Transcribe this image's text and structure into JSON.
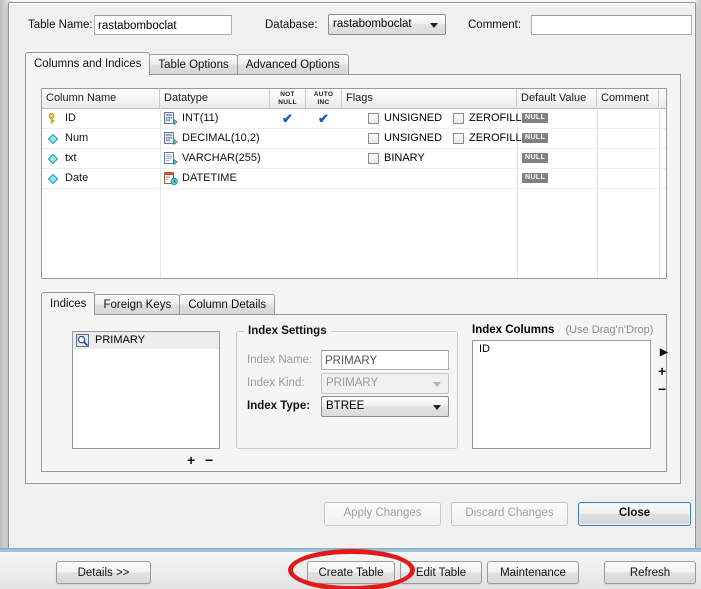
{
  "header": {
    "table_name_label": "Table Name:",
    "table_name_value": "rastabomboclat",
    "database_label": "Database:",
    "database_value": "rastabomboclat",
    "comment_label": "Comment:",
    "comment_value": ""
  },
  "main_tabs": [
    {
      "label": "Columns and Indices",
      "active": true
    },
    {
      "label": "Table Options",
      "active": false
    },
    {
      "label": "Advanced Options",
      "active": false
    }
  ],
  "columns_grid": {
    "headers": [
      "Column Name",
      "Datatype",
      "NOT NULL",
      "AUTO INC",
      "Flags",
      "Default Value",
      "Comment"
    ],
    "header_not_null_line1": "NOT",
    "header_not_null_line2": "NULL",
    "header_auto_inc_line1": "AUTO",
    "header_auto_inc_line2": "INC",
    "rows": [
      {
        "icon": "primary-key-icon",
        "name": "ID",
        "datatype": "INT(11)",
        "datatype_icon": "integer-type-icon",
        "not_null": true,
        "auto_inc": true,
        "flags": [
          {
            "label": "UNSIGNED",
            "checked": false
          },
          {
            "label": "ZEROFILL",
            "checked": false
          }
        ],
        "default_value": "NULL",
        "comment": ""
      },
      {
        "icon": "column-icon",
        "name": "Num",
        "datatype": "DECIMAL(10,2)",
        "datatype_icon": "numeric-type-icon",
        "not_null": false,
        "auto_inc": false,
        "flags": [
          {
            "label": "UNSIGNED",
            "checked": false
          },
          {
            "label": "ZEROFILL",
            "checked": false
          }
        ],
        "default_value": "NULL",
        "comment": ""
      },
      {
        "icon": "column-icon",
        "name": "txt",
        "datatype": "VARCHAR(255)",
        "datatype_icon": "text-type-icon",
        "not_null": false,
        "auto_inc": false,
        "flags": [
          {
            "label": "BINARY",
            "checked": false
          }
        ],
        "default_value": "NULL",
        "comment": ""
      },
      {
        "icon": "column-icon",
        "name": "Date",
        "datatype": "DATETIME",
        "datatype_icon": "datetime-type-icon",
        "not_null": false,
        "auto_inc": false,
        "flags": [],
        "default_value": "NULL",
        "comment": ""
      }
    ]
  },
  "sub_tabs": [
    {
      "label": "Indices",
      "active": true
    },
    {
      "label": "Foreign Keys",
      "active": false
    },
    {
      "label": "Column Details",
      "active": false
    }
  ],
  "indices_panel": {
    "index_list": [
      "PRIMARY"
    ],
    "add_button": "+",
    "remove_button": "−",
    "settings": {
      "group_title": "Index Settings",
      "index_name_label": "Index Name:",
      "index_name_value": "PRIMARY",
      "index_kind_label": "Index Kind:",
      "index_kind_value": "PRIMARY",
      "index_type_label": "Index Type:",
      "index_type_value": "BTREE"
    },
    "index_columns": {
      "title": "Index Columns",
      "hint": "(Use Drag'n'Drop)",
      "items": [
        "ID"
      ],
      "expand_button": "▶",
      "add_button": "+",
      "remove_button": "−"
    }
  },
  "dialog_buttons": [
    {
      "label": "Apply Changes",
      "disabled": true,
      "default": false
    },
    {
      "label": "Discard Changes",
      "disabled": true,
      "default": false
    },
    {
      "label": "Close",
      "disabled": false,
      "default": true
    }
  ],
  "bottom_toolbar": {
    "details_button": "Details >>",
    "buttons": [
      {
        "label": "Create Table",
        "highlighted": true
      },
      {
        "label": "Edit Table",
        "highlighted": false
      },
      {
        "label": "Maintenance",
        "highlighted": false
      },
      {
        "label": "Refresh",
        "highlighted": false
      }
    ]
  },
  "annotation": {
    "shape": "ellipse",
    "color": "#e01b1b",
    "targets": "Create Table"
  }
}
